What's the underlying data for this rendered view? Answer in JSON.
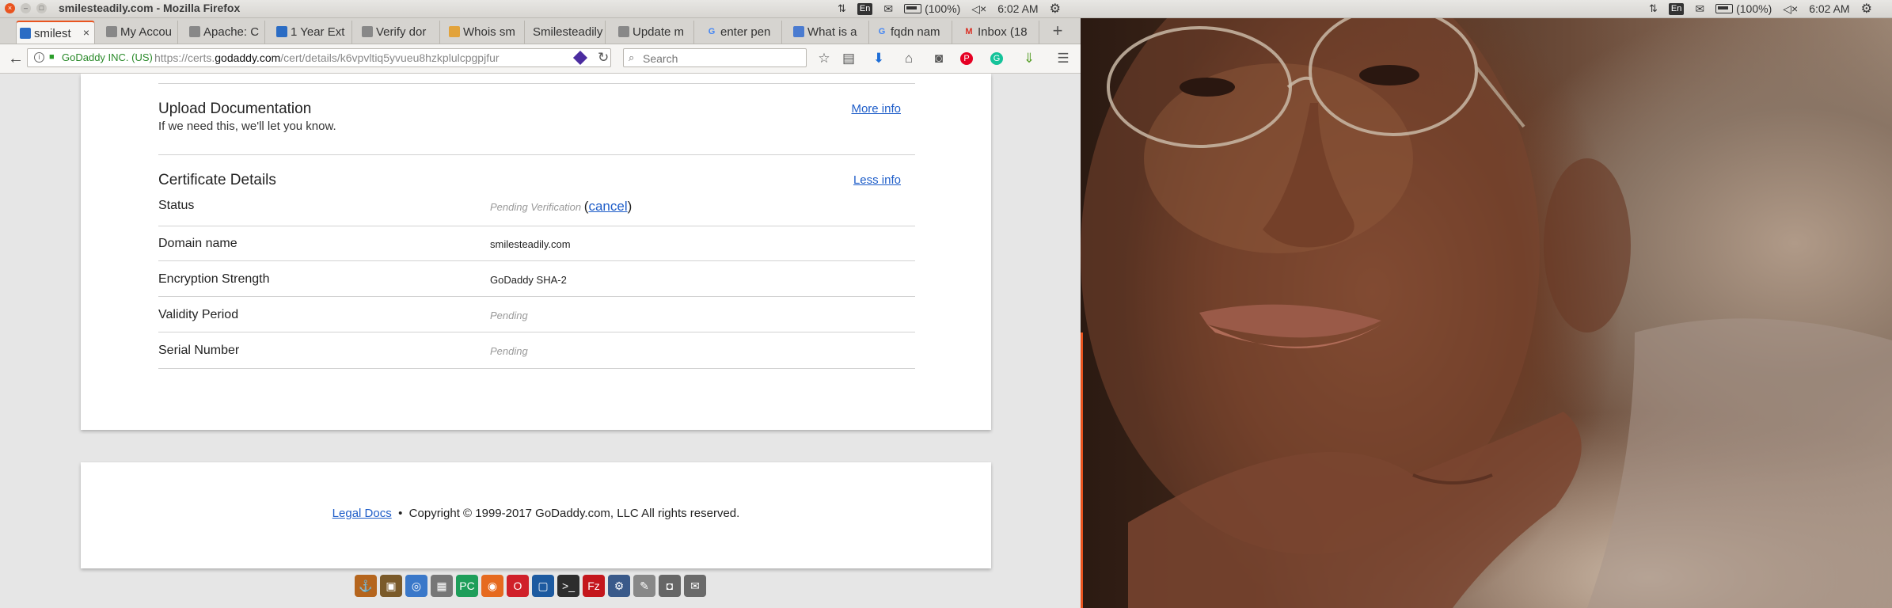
{
  "window": {
    "title": "smilesteadily.com - Mozilla Firefox",
    "close_glyph": "×",
    "min_glyph": "–",
    "max_glyph": "□"
  },
  "tray": {
    "keyboard": "En",
    "battery": "(100%)",
    "clock": "6:02 AM"
  },
  "tabs": [
    {
      "label": "smilest",
      "color": "#2b6cc4",
      "icon": "godaddy-favicon",
      "active": true
    },
    {
      "label": "My Accou",
      "color": "#888888",
      "icon": "generic-favicon"
    },
    {
      "label": "Apache: C",
      "color": "#888888",
      "icon": "generic-favicon"
    },
    {
      "label": "1 Year Ext",
      "color": "#2b6cc4",
      "icon": "godaddy-favicon"
    },
    {
      "label": "Verify dor",
      "color": "#888888",
      "icon": "generic-favicon"
    },
    {
      "label": "Whois sm",
      "color": "#e2a33b",
      "icon": "whois-favicon"
    },
    {
      "label": "Smilesteadily",
      "color": "#888888",
      "icon": "generic-favicon"
    },
    {
      "label": "Update m",
      "color": "#888888",
      "icon": "generic-favicon"
    },
    {
      "label": "enter pen",
      "color": "#4285f4",
      "icon": "google-favicon"
    },
    {
      "label": "What is a",
      "color": "#4a7bd0",
      "icon": "shield-favicon"
    },
    {
      "label": "fqdn nam",
      "color": "#4285f4",
      "icon": "google-favicon"
    },
    {
      "label": "Inbox (18",
      "color": "#d93025",
      "icon": "gmail-favicon"
    }
  ],
  "tab_close": "×",
  "new_tab": "+",
  "navbar": {
    "back": "←",
    "info": "i",
    "identity": "GoDaddy INC. (US)",
    "url_prefix": "https://certs.",
    "url_host": "godaddy.com",
    "url_path": "/cert/details/k6vpvltiq5yvueu8hzkplulcpgpjfur",
    "reload": "↻",
    "search_placeholder": "Search",
    "icons": [
      "☆",
      "▤",
      "⬇",
      "⌂",
      "◙",
      "P",
      "G",
      "⇓",
      "☰"
    ]
  },
  "upload": {
    "title": "Upload Documentation",
    "subtitle": "If we need this, we'll let you know.",
    "link": "More info"
  },
  "details": {
    "title": "Certificate Details",
    "link": "Less info",
    "rows": {
      "status": {
        "label": "Status",
        "value": "Pending Verification",
        "paren_open": "(",
        "action": "cancel",
        "paren_close": ")"
      },
      "domain": {
        "label": "Domain name",
        "value": "smilesteadily.com"
      },
      "encryption": {
        "label": "Encryption Strength",
        "value": "GoDaddy SHA-2"
      },
      "validity": {
        "label": "Validity Period",
        "value": "Pending"
      },
      "serial": {
        "label": "Serial Number",
        "value": "Pending"
      }
    }
  },
  "footer": {
    "legal_link": "Legal Docs",
    "bullet": "•",
    "copyright": "Copyright © 1999-2017 GoDaddy.com, LLC All rights reserved."
  },
  "dock": [
    {
      "name": "anchor-app-icon",
      "glyph": "⚓",
      "color": "#b5651d"
    },
    {
      "name": "installer-app-icon",
      "glyph": "▣",
      "color": "#7a5a2a"
    },
    {
      "name": "chromium-app-icon",
      "glyph": "◎",
      "color": "#3a78c9"
    },
    {
      "name": "files-app-icon",
      "glyph": "▦",
      "color": "#777777"
    },
    {
      "name": "pycharm-app-icon",
      "glyph": "PC",
      "color": "#1e9e5a"
    },
    {
      "name": "firefox-app-icon",
      "glyph": "◉",
      "color": "#e66a1f"
    },
    {
      "name": "opera-app-icon",
      "glyph": "O",
      "color": "#d0202a"
    },
    {
      "name": "virtualbox-app-icon",
      "glyph": "▢",
      "color": "#1d5aa0"
    },
    {
      "name": "terminal-app-icon",
      "glyph": ">_",
      "color": "#2d2d2d"
    },
    {
      "name": "filezilla-app-icon",
      "glyph": "Fz",
      "color": "#c4161c"
    },
    {
      "name": "network-app-icon",
      "glyph": "⚙",
      "color": "#3a5a8a"
    },
    {
      "name": "text-editor-app-icon",
      "glyph": "✎",
      "color": "#888888"
    },
    {
      "name": "screenshot-app-icon",
      "glyph": "◘",
      "color": "#666666"
    },
    {
      "name": "mail-app-icon",
      "glyph": "✉",
      "color": "#6a6a6a"
    }
  ]
}
